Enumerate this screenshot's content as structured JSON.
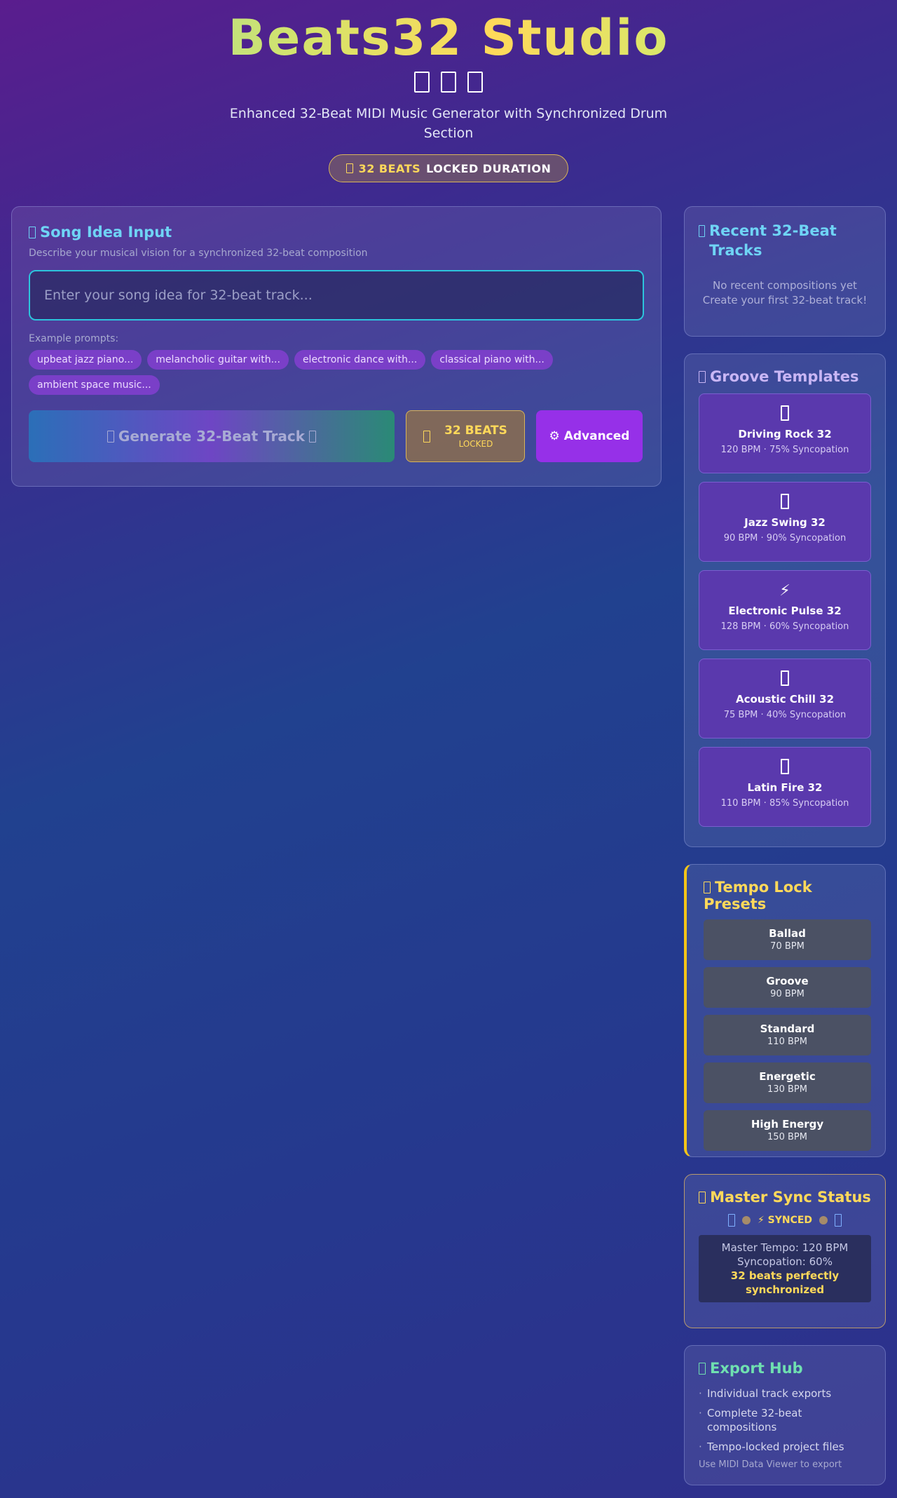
{
  "header": {
    "title": "Beats32 Studio",
    "subtitle": "Enhanced 32-Beat MIDI Music Generator with Synchronized Drum Section",
    "badge_highlight": "32 BEATS",
    "badge_text": "LOCKED DURATION"
  },
  "song_input": {
    "title": "Song Idea Input",
    "description": "Describe your musical vision for a synchronized 32-beat composition",
    "placeholder": "Enter your song idea for 32-beat track...",
    "examples_label": "Example prompts:",
    "examples": [
      "upbeat jazz piano...",
      "melancholic guitar with...",
      "electronic dance with...",
      "classical piano with...",
      "ambient space music..."
    ],
    "generate_label": "Generate 32-Beat Track",
    "beats_label": "32 BEATS",
    "beats_sub": "LOCKED",
    "advanced_label": "⚙ Advanced"
  },
  "recent": {
    "title": "Recent 32-Beat Tracks",
    "empty_line1": "No recent compositions yet",
    "empty_line2": "Create your first 32-beat track!"
  },
  "groove": {
    "title": "Groove Templates",
    "templates": [
      {
        "icon": "box",
        "name": "Driving Rock 32",
        "meta": "120 BPM · 75% Syncopation"
      },
      {
        "icon": "box",
        "name": "Jazz Swing 32",
        "meta": "90 BPM · 90% Syncopation"
      },
      {
        "icon": "⚡",
        "name": "Electronic Pulse 32",
        "meta": "128 BPM · 60% Syncopation"
      },
      {
        "icon": "box",
        "name": "Acoustic Chill 32",
        "meta": "75 BPM · 40% Syncopation"
      },
      {
        "icon": "box",
        "name": "Latin Fire 32",
        "meta": "110 BPM · 85% Syncopation"
      }
    ]
  },
  "tempo": {
    "title": "Tempo Lock Presets",
    "presets": [
      {
        "name": "Ballad",
        "bpm": "70 BPM"
      },
      {
        "name": "Groove",
        "bpm": "90 BPM"
      },
      {
        "name": "Standard",
        "bpm": "110 BPM"
      },
      {
        "name": "Energetic",
        "bpm": "130 BPM"
      },
      {
        "name": "High Energy",
        "bpm": "150 BPM"
      }
    ]
  },
  "sync": {
    "title": "Master Sync Status",
    "status": "⚡ SYNCED",
    "master_tempo": "Master Tempo: 120 BPM",
    "syncopation": "Syncopation: 60%",
    "confirm": "32 beats perfectly synchronized"
  },
  "export": {
    "title": "Export Hub",
    "items": [
      "Individual track exports",
      "Complete 32-beat compositions",
      "Tempo-locked project files"
    ],
    "note": "Use MIDI Data Viewer to export"
  },
  "colors": {
    "accent_cyan": "#2cc4dc",
    "accent_yellow": "#ffd95a",
    "accent_purple": "#9630e8"
  }
}
